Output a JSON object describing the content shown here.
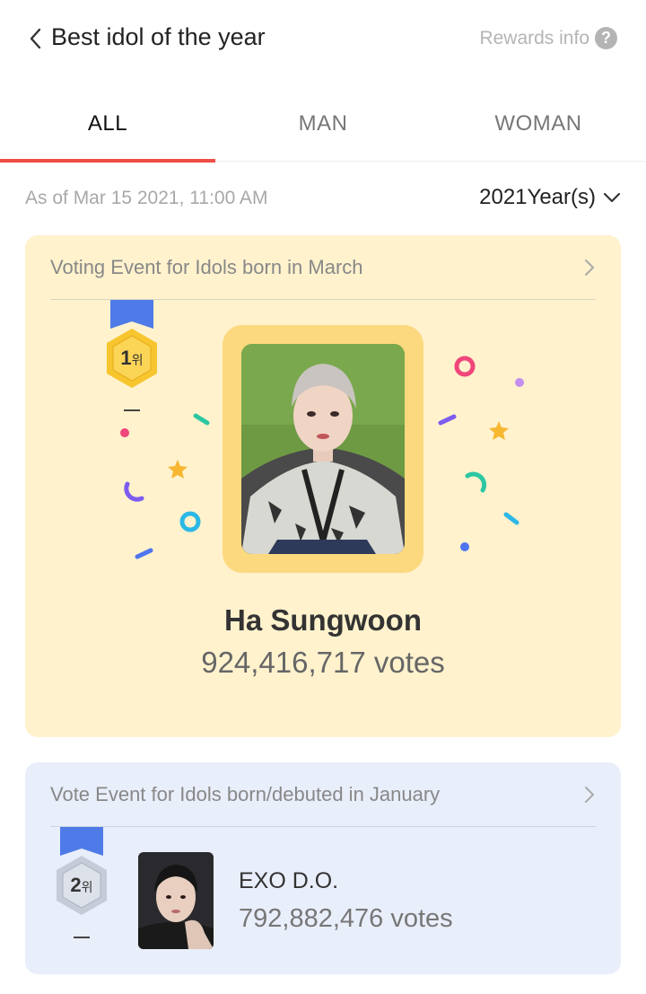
{
  "header": {
    "title": "Best idol of the year",
    "rewards_label": "Rewards info",
    "help_glyph": "?",
    "back_icon": "chevron-left-icon"
  },
  "tabs": [
    {
      "label": "ALL",
      "active": true
    },
    {
      "label": "MAN",
      "active": false
    },
    {
      "label": "WOMAN",
      "active": false
    }
  ],
  "meta": {
    "as_of": "As of Mar 15 2021, 11:00 AM",
    "year": "2021Year(s)"
  },
  "events": [
    {
      "title": "Voting Event for Idols born in March",
      "rank": "1",
      "rank_suffix": "위",
      "name": "Ha Sungwoon",
      "votes": "924,416,717 votes",
      "card_color": "#fff2cd",
      "medal_color": "#f7c52e"
    },
    {
      "title": "Vote Event for Idols born/debuted in January",
      "rank": "2",
      "rank_suffix": "위",
      "name": "EXO D.O.",
      "votes": "792,882,476 votes",
      "card_color": "#e9eefb",
      "medal_color": "#c5ccd8"
    }
  ],
  "colors": {
    "accent": "#ef4d45",
    "ribbon": "#4f7be8"
  }
}
